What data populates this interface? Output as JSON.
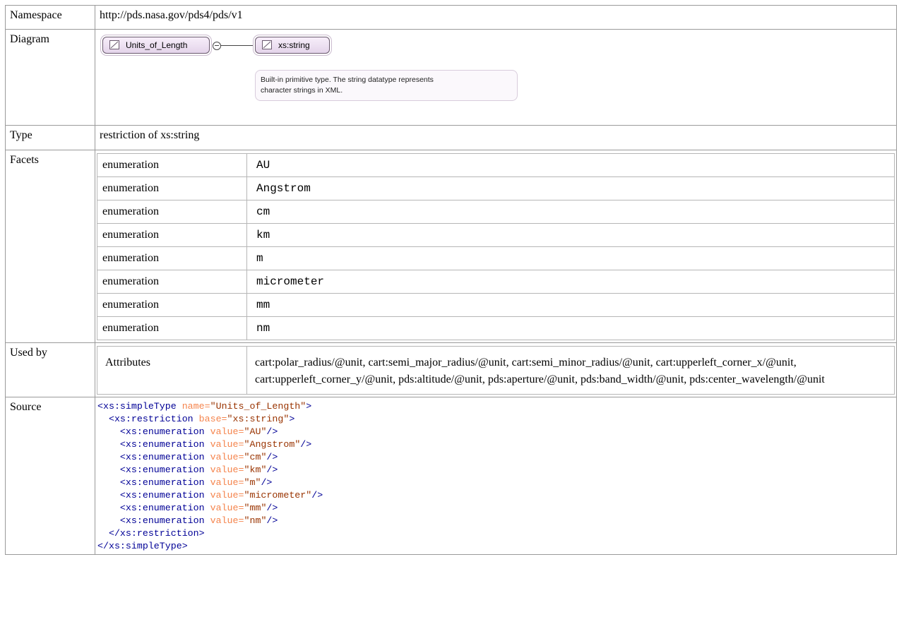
{
  "namespace": {
    "label": "Namespace",
    "value": "http://pds.nasa.gov/pds4/pds/v1"
  },
  "diagram": {
    "label": "Diagram",
    "type_node": "Units_of_Length",
    "base_node": "xs:string",
    "documentation": [
      "Built-in primitive type. The string datatype represents",
      "character strings in XML."
    ]
  },
  "type": {
    "label": "Type",
    "value": "restriction of xs:string"
  },
  "facets": {
    "label": "Facets",
    "rows": [
      {
        "kind": "enumeration",
        "value": "AU"
      },
      {
        "kind": "enumeration",
        "value": "Angstrom"
      },
      {
        "kind": "enumeration",
        "value": "cm"
      },
      {
        "kind": "enumeration",
        "value": "km"
      },
      {
        "kind": "enumeration",
        "value": "m"
      },
      {
        "kind": "enumeration",
        "value": "micrometer"
      },
      {
        "kind": "enumeration",
        "value": "mm"
      },
      {
        "kind": "enumeration",
        "value": "nm"
      }
    ]
  },
  "used_by": {
    "label": "Used by",
    "kind": "Attributes",
    "value": "cart:polar_radius/@unit, cart:semi_major_radius/@unit, cart:semi_minor_radius/@unit, cart:upperleft_corner_x/@unit, cart:upperleft_corner_y/@unit, pds:altitude/@unit, pds:aperture/@unit, pds:band_width/@unit, pds:center_wavelength/@unit"
  },
  "source": {
    "label": "Source",
    "type_name": "Units_of_Length",
    "restriction_base": "xs:string",
    "values": [
      "AU",
      "Angstrom",
      "cm",
      "km",
      "m",
      "micrometer",
      "mm",
      "nm"
    ]
  }
}
